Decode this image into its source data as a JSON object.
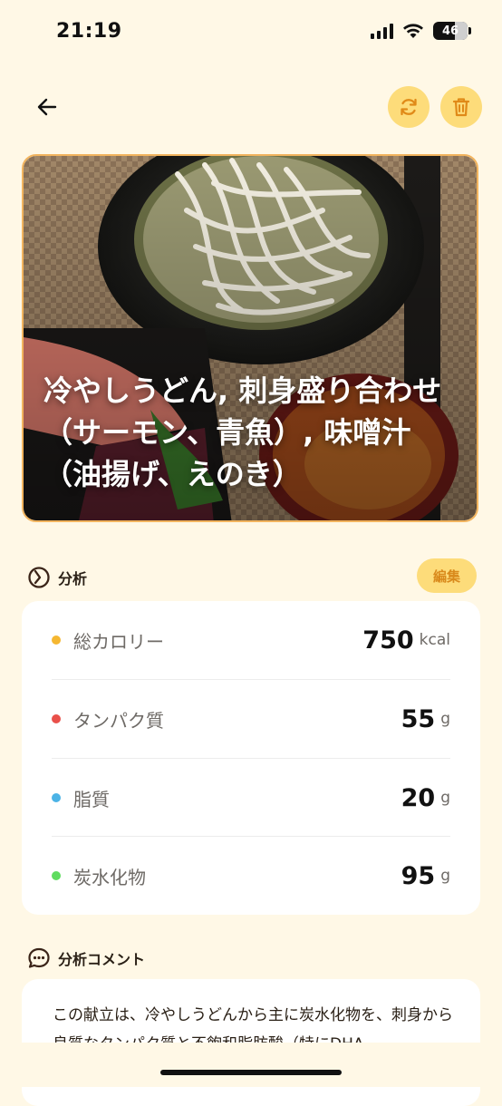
{
  "status_bar": {
    "time": "21:19",
    "battery": "46"
  },
  "header": {
    "back_icon": "arrow-left-icon",
    "refresh_icon": "refresh-icon",
    "delete_icon": "trash-icon"
  },
  "meal": {
    "title": "冷やしうどん, 刺身盛り合わせ（サーモン、青魚）, 味噌汁（油揚げ、えのき）"
  },
  "analysis": {
    "label": "分析",
    "edit_label": "編集",
    "icon": "gauge-icon",
    "items": [
      {
        "name": "総カロリー",
        "value": "750",
        "unit": "kcal",
        "color": "#f5b731"
      },
      {
        "name": "タンパク質",
        "value": "55",
        "unit": "g",
        "color": "#e9504a"
      },
      {
        "name": "脂質",
        "value": "20",
        "unit": "g",
        "color": "#4bb3e6"
      },
      {
        "name": "炭水化物",
        "value": "95",
        "unit": "g",
        "color": "#5fdc5f"
      }
    ]
  },
  "comment": {
    "label": "分析コメント",
    "icon": "chat-bubble-icon",
    "text": "この献立は、冷やしうどんから主に炭水化物を、刺身から良質なタンパク質と不飽和脂肪酸（特にDHA"
  },
  "colors": {
    "background": "#fff8e6",
    "accent": "#fddc7a",
    "accent_text": "#d98a1c",
    "hero_border": "#f2b45e"
  }
}
